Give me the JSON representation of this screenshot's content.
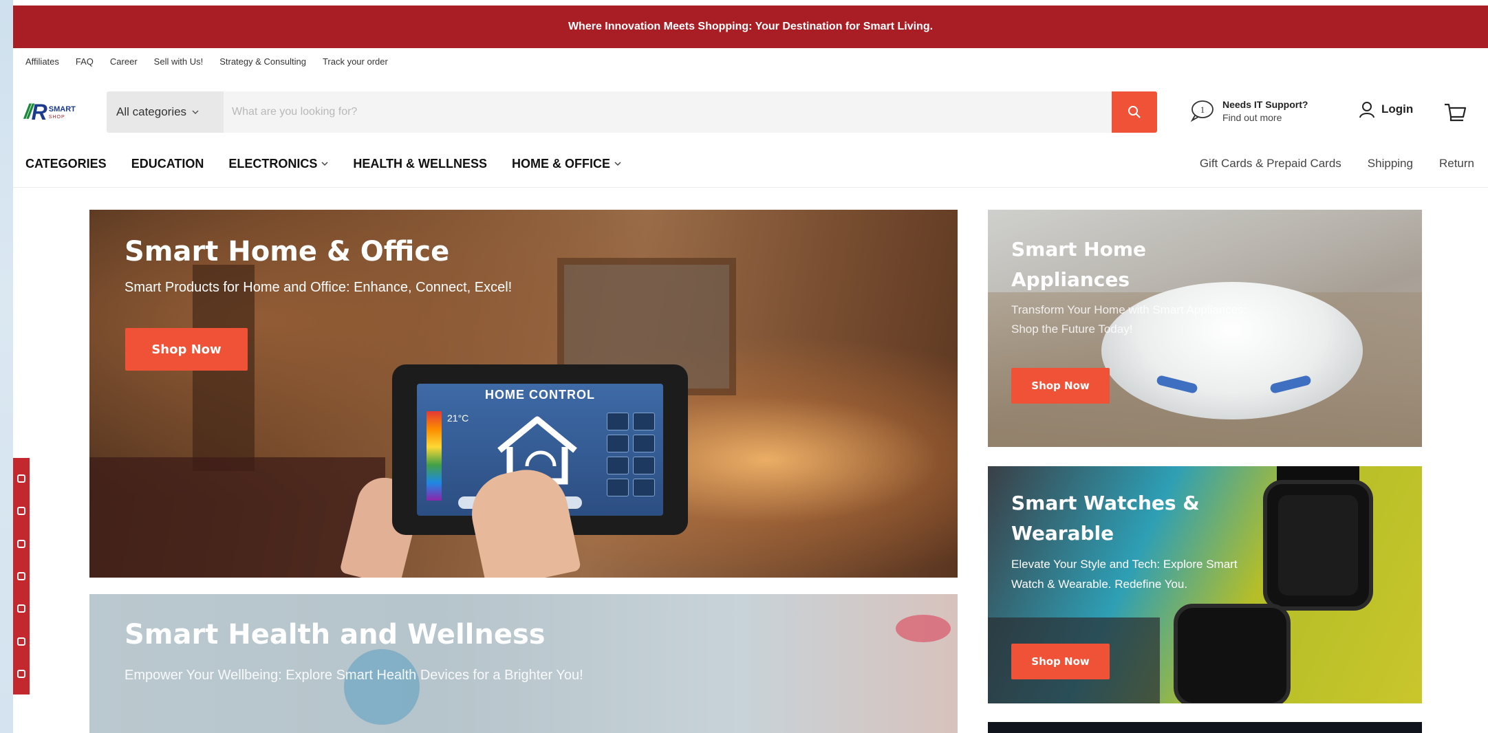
{
  "announcement": "Where Innovation Meets Shopping: Your Destination for Smart Living.",
  "top_links": [
    "Affiliates",
    "FAQ",
    "Career",
    "Sell with Us!",
    "Strategy & Consulting",
    "Track your order"
  ],
  "logo": {
    "main": "SMART",
    "sub": "SHOP"
  },
  "search": {
    "category_label": "All categories",
    "placeholder": "What are you looking for?",
    "value": ""
  },
  "support": {
    "title": "Needs IT Support?",
    "subtitle": "Find out more",
    "badge": "1"
  },
  "login_label": "Login",
  "nav": {
    "left": [
      {
        "label": "CATEGORIES",
        "dropdown": false
      },
      {
        "label": "EDUCATION",
        "dropdown": false
      },
      {
        "label": "ELECTRONICS",
        "dropdown": true
      },
      {
        "label": "HEALTH & WELLNESS",
        "dropdown": false
      },
      {
        "label": "HOME & OFFICE",
        "dropdown": true
      }
    ],
    "right": [
      "Gift Cards & Prepaid Cards",
      "Shipping",
      "Return"
    ]
  },
  "banners": {
    "home_office": {
      "title": "Smart Home & Office",
      "subtitle": "Smart Products for Home and Office: Enhance, Connect, Excel!",
      "button": "Shop Now",
      "screen_title": "HOME CONTROL",
      "screen_temp": "21°C"
    },
    "appliances": {
      "title_line1": "Smart Home",
      "title_line2": "Appliances",
      "subtitle": "Transform Your Home with Smart Appliances: Shop the Future Today!",
      "button": "Shop Now"
    },
    "watches": {
      "title_line1": "Smart Watches &",
      "title_line2": "Wearable",
      "subtitle": "Elevate Your Style and Tech: Explore Smart Watch & Wearable. Redefine You.",
      "button": "Shop Now"
    },
    "health": {
      "title": "Smart Health and Wellness",
      "subtitle": "Empower Your Wellbeing: Explore Smart Health Devices for a Brighter You!"
    }
  },
  "colors": {
    "brand_red": "#a91e25",
    "accent_orange": "#ef5237"
  },
  "icons": [
    "search-icon",
    "chat-bubble-icon",
    "user-icon",
    "cart-icon",
    "chevron-down-icon"
  ]
}
